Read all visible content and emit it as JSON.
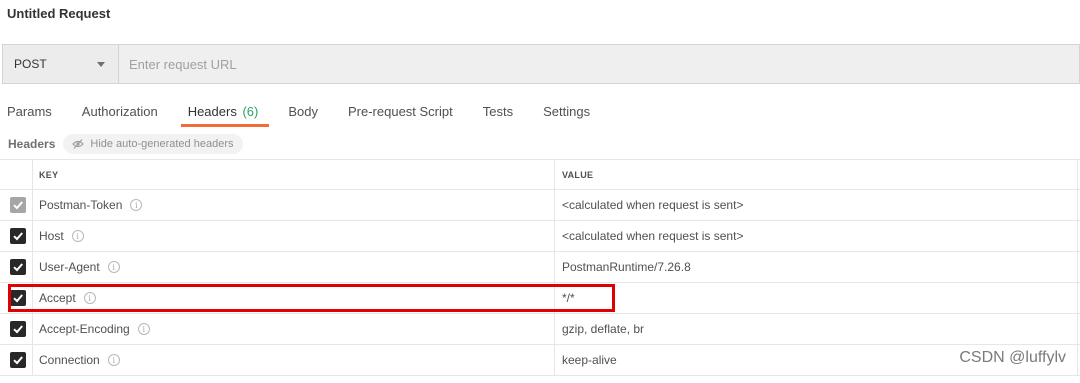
{
  "request": {
    "title": "Untitled Request",
    "method": "POST",
    "url_value": "",
    "url_placeholder": "Enter request URL"
  },
  "tabs": [
    {
      "label": "Params"
    },
    {
      "label": "Authorization"
    },
    {
      "label": "Headers",
      "count": "(6)",
      "active": true
    },
    {
      "label": "Body"
    },
    {
      "label": "Pre-request Script"
    },
    {
      "label": "Tests"
    },
    {
      "label": "Settings"
    }
  ],
  "headers_section": {
    "title": "Headers",
    "toggle_label": "Hide auto-generated headers",
    "toggle_icon": "eye-off-icon"
  },
  "table": {
    "columns": {
      "key": "KEY",
      "value": "VALUE"
    },
    "rows": [
      {
        "key": "Postman-Token",
        "value": "<calculated when request is sent>",
        "checked": true,
        "disabled": true
      },
      {
        "key": "Host",
        "value": "<calculated when request is sent>",
        "checked": true
      },
      {
        "key": "User-Agent",
        "value": "PostmanRuntime/7.26.8",
        "checked": true
      },
      {
        "key": "Accept",
        "value": "*/*",
        "checked": true,
        "highlighted": true
      },
      {
        "key": "Accept-Encoding",
        "value": "gzip, deflate, br",
        "checked": true
      },
      {
        "key": "Connection",
        "value": "keep-alive",
        "checked": true
      }
    ]
  },
  "colors": {
    "active_tab_underline": "#f26b3a",
    "count_green": "#26a65b",
    "highlight_red": "#e00000"
  },
  "watermark": "CSDN @luffylv"
}
